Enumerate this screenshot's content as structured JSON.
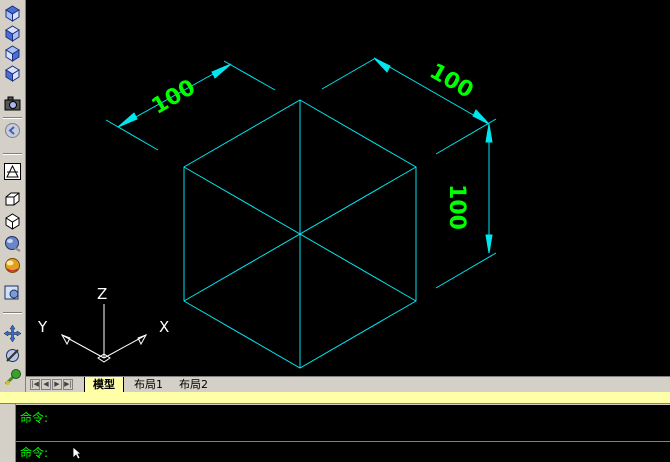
{
  "toolbar": {
    "icons": [
      "top-view-icon",
      "bottom-view-icon",
      "left-view-icon",
      "right-view-icon",
      "camera-icon",
      "orbit-icon",
      "ucs-icon",
      "box-icon",
      "cube-icon",
      "sphere-icon",
      "render-icon",
      "view-icon",
      "pan-icon",
      "rotate-icon",
      "tree-icon"
    ]
  },
  "drawing": {
    "dim_left": "100",
    "dim_right": "100",
    "dim_vertical": "100",
    "axis_z": "Z",
    "axis_y": "Y",
    "axis_x": "X",
    "colors": {
      "cube": "#00e5ee",
      "dim_text": "#00ff00",
      "arrow": "#00e5ee",
      "axis": "#ffffff"
    }
  },
  "tabs": {
    "model": "模型",
    "layout1": "布局1",
    "layout2": "布局2"
  },
  "command": {
    "history": "命令:",
    "prompt": "命令:"
  }
}
